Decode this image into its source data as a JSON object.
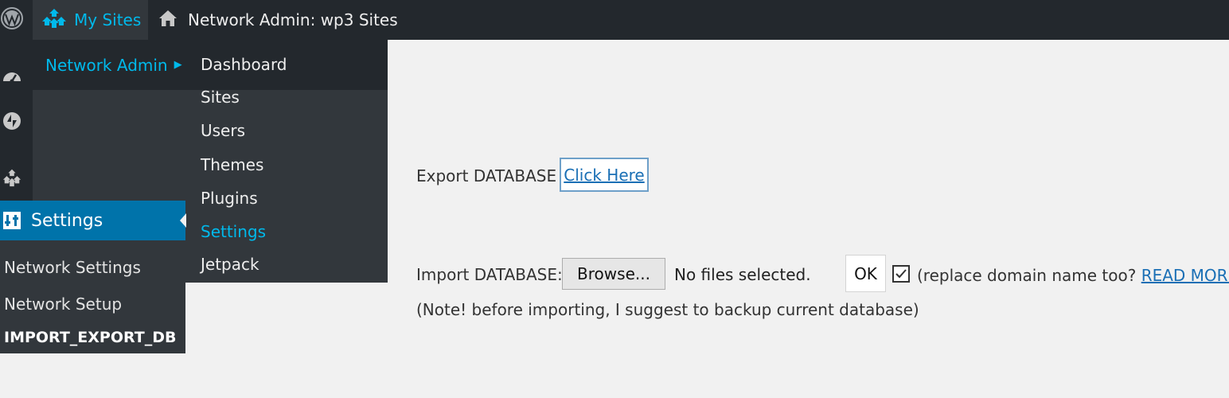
{
  "admin_bar": {
    "wp_logo_icon": "wordpress-logo-icon",
    "my_sites_label": "My Sites",
    "my_sites_icon": "network-sites-icon",
    "network_admin_title": "Network Admin: wp3 Sites",
    "home_icon": "home-icon"
  },
  "my_sites_menu": {
    "network_admin_label": "Network Admin",
    "arrow": "▶",
    "submenu": [
      {
        "label": "Dashboard"
      },
      {
        "label": "Sites"
      },
      {
        "label": "Users"
      },
      {
        "label": "Themes"
      },
      {
        "label": "Plugins"
      },
      {
        "label": "Settings",
        "current": true
      },
      {
        "label": "Jetpack"
      }
    ]
  },
  "admin_menu": {
    "icons": [
      "dashboard-icon",
      "jetpack-icon",
      "sites-icon"
    ],
    "settings_label": "Settings",
    "settings_icon": "settings-icon",
    "settings_submenu": [
      {
        "label": "Network Settings"
      },
      {
        "label": "Network Setup"
      },
      {
        "label": "IMPORT_EXPORT_DB"
      }
    ]
  },
  "main": {
    "export_label": "Export DATABASE :",
    "export_link": "Click Here",
    "import_label": "Import DATABASE:",
    "browse_label": "Browse...",
    "file_status": "No files selected.",
    "ok_label": "OK",
    "replace_checked": true,
    "replace_text_before": "(replace domain name too? ",
    "read_more_link": "READ MORE",
    "replace_text_after": ")",
    "note": "(Note! before importing, I suggest to backup current database)"
  },
  "colors": {
    "admin_bar_bg": "#23282d",
    "menu_bg": "#32373c",
    "accent": "#00b9eb",
    "active_menu": "#0073aa",
    "link": "#1a6fb5"
  }
}
